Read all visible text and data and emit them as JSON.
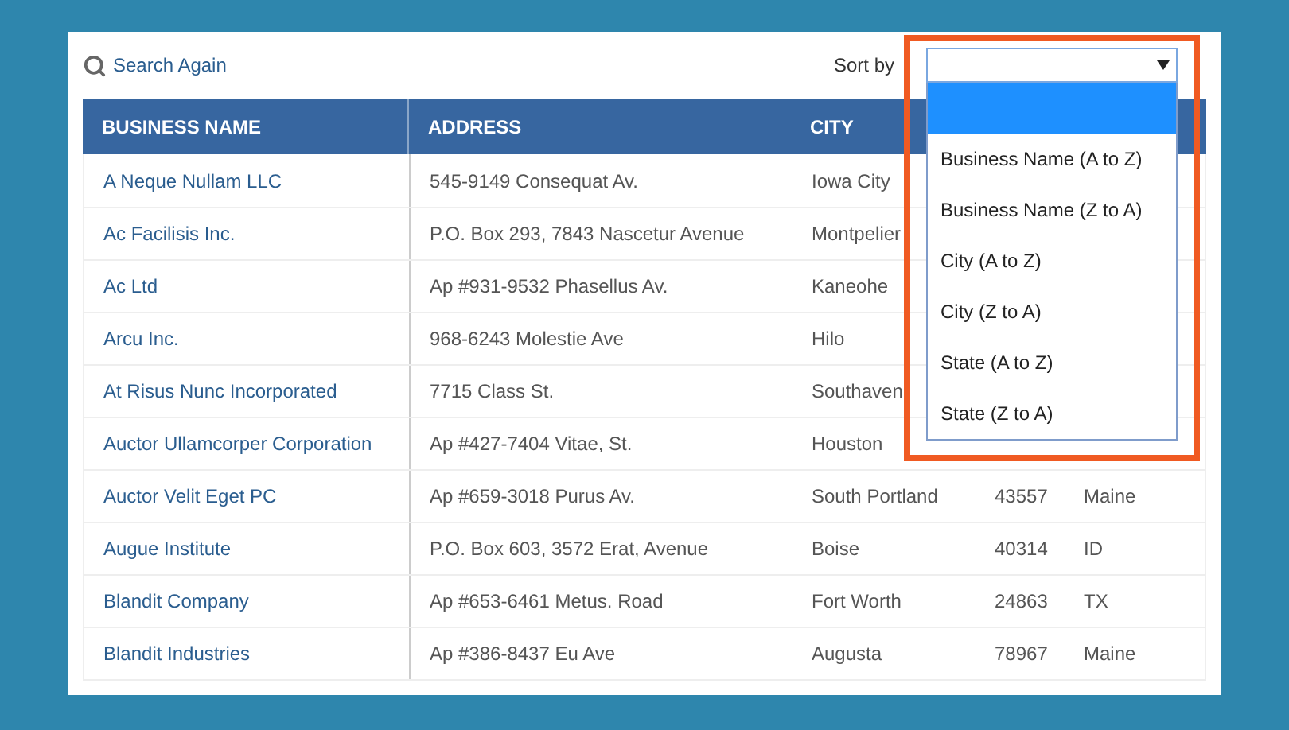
{
  "toolbar": {
    "search_link": "Search Again",
    "sort_label": "Sort by"
  },
  "sort_dropdown": {
    "expanded": true,
    "options": [
      {
        "selected": true
      },
      {
        "label": "Business Name (A to Z)",
        "selected": false
      },
      {
        "label": "Business Name (Z to A)",
        "selected": false
      },
      {
        "label": "City (A to Z)",
        "selected": false
      },
      {
        "label": "City (Z to A)",
        "selected": false
      },
      {
        "label": "State (A to Z)",
        "selected": false
      },
      {
        "label": "State (Z to A)",
        "selected": false
      }
    ]
  },
  "table": {
    "columns": [
      "BUSINESS NAME",
      "ADDRESS",
      "CITY"
    ],
    "rows": [
      {
        "name": "A Neque Nullam LLC",
        "address": "545-9149 Consequat Av.",
        "city": "Iowa City"
      },
      {
        "name": "Ac Facilisis Inc.",
        "address": "P.O. Box 293, 7843 Nascetur Avenue",
        "city": "Montpelier"
      },
      {
        "name": "Ac Ltd",
        "address": "Ap #931-9532 Phasellus Av.",
        "city": "Kaneohe"
      },
      {
        "name": "Arcu Inc.",
        "address": "968-6243 Molestie Ave",
        "city": "Hilo"
      },
      {
        "name": "At Risus Nunc Incorporated",
        "address": "7715 Class St.",
        "city": "Southaven"
      },
      {
        "name": "Auctor Ullamcorper Corporation",
        "address": "Ap #427-7404 Vitae, St.",
        "city": "Houston"
      },
      {
        "name": "Auctor Velit Eget PC",
        "address": "Ap #659-3018 Purus Av.",
        "city": "South Portland",
        "zip": "43557",
        "state": "Maine"
      },
      {
        "name": "Augue Institute",
        "address": "P.O. Box 603, 3572 Erat, Avenue",
        "city": "Boise",
        "zip": "40314",
        "state": "ID"
      },
      {
        "name": "Blandit Company",
        "address": "Ap #653-6461 Metus. Road",
        "city": "Fort Worth",
        "zip": "24863",
        "state": "TX"
      },
      {
        "name": "Blandit Industries",
        "address": "Ap #386-8437 Eu Ave",
        "city": "Augusta",
        "zip": "78967",
        "state": "Maine"
      }
    ]
  }
}
